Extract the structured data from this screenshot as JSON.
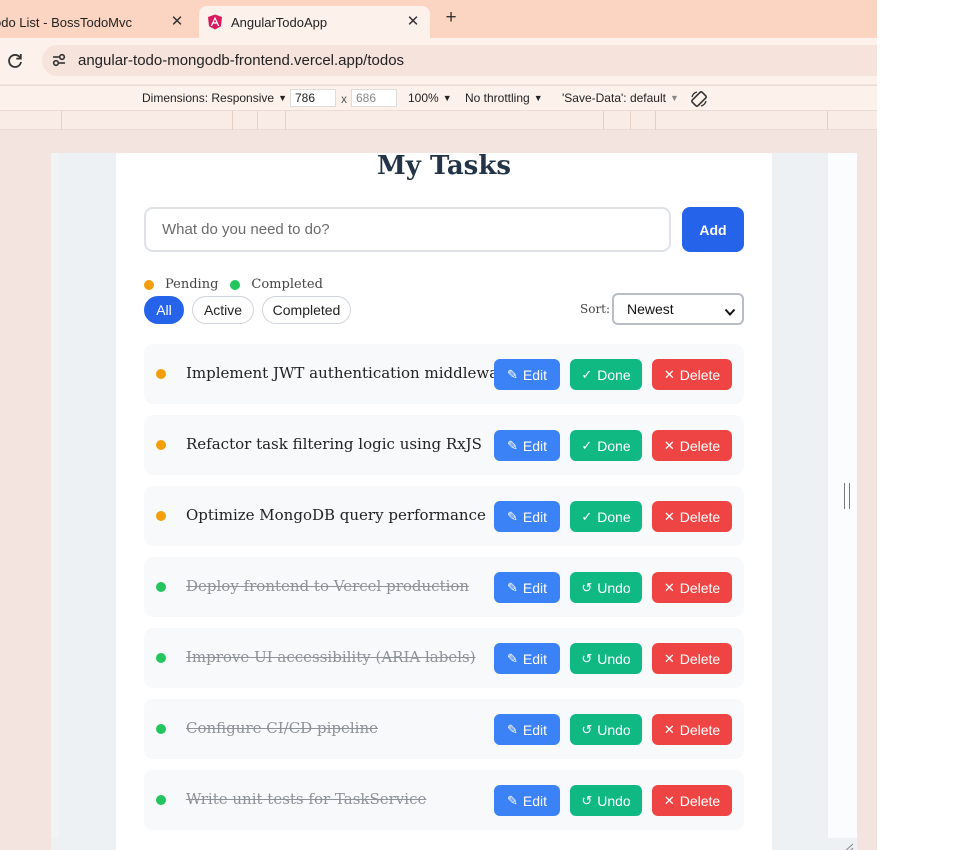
{
  "browser": {
    "tabs": [
      {
        "title": "odo List - BossTodoMvc",
        "close": "✕"
      },
      {
        "title": "AngularTodoApp",
        "close": "✕"
      }
    ],
    "new_tab": "+",
    "url": "angular-todo-mongodb-frontend.vercel.app/todos"
  },
  "devtools": {
    "dimensions": "Dimensions: Responsive",
    "width": "786",
    "height": "686",
    "times": "x",
    "zoom": "100%",
    "throttling": "No throttling",
    "save_data": "'Save-Data': default"
  },
  "app": {
    "title": "My Tasks",
    "input_placeholder": "What do you need to do?",
    "add_label": "Add",
    "legend": {
      "pending": "Pending",
      "completed": "Completed"
    },
    "filters": {
      "all": "All",
      "active": "Active",
      "completed": "Completed"
    },
    "sort_label": "Sort:",
    "sort_value": "Newest",
    "colors": {
      "pending": "#f59e0b",
      "completed": "#22c55e",
      "primary": "#2563eb",
      "edit": "#3b82f6",
      "done": "#10b981",
      "delete": "#ef4444"
    },
    "labels": {
      "edit": "Edit",
      "done": "Done",
      "undo": "Undo",
      "delete": "Delete"
    },
    "icons": {
      "edit": "✎",
      "done": "✓",
      "undo": "↺",
      "delete": "✕"
    },
    "tasks": [
      {
        "text": "Implement JWT authentication middleware",
        "completed": false
      },
      {
        "text": "Refactor task filtering logic using RxJS",
        "completed": false
      },
      {
        "text": "Optimize MongoDB query performance",
        "completed": false
      },
      {
        "text": "Deploy frontend to Vercel production",
        "completed": true
      },
      {
        "text": "Improve UI accessibility (ARIA labels)",
        "completed": true
      },
      {
        "text": "Configure CI/CD pipeline",
        "completed": true
      },
      {
        "text": "Write unit tests for TaskService",
        "completed": true
      }
    ]
  }
}
